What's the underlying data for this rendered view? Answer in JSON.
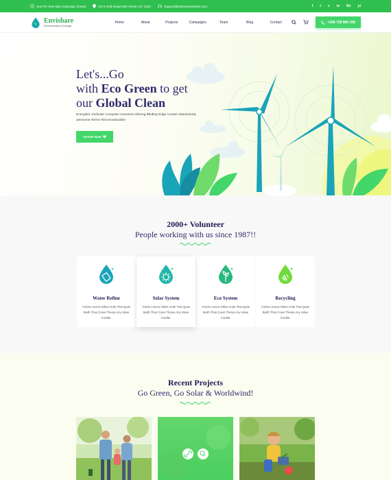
{
  "topbar": {
    "hours": "Sun-Fri: 9am-6pm Saturday Closed",
    "address": "4/2 K Soft Road 24th Street, NY 1202",
    "email": "Support@adminenvishare.com",
    "social": [
      "f",
      "t",
      "v",
      "in",
      "Be",
      "yt"
    ]
  },
  "nav": {
    "logo_name": "Envishare",
    "logo_sub": "Environmental & Ecology",
    "menu": [
      "Home",
      "About",
      "Projects",
      "Campaigns",
      "Team",
      "Blog",
      "Contact"
    ],
    "phone": "+208 728 980 158"
  },
  "hero": {
    "line1": "Let's...Go",
    "line2_pre": "with ",
    "line2_bold": "Eco Green",
    "line2_post": " to get",
    "line3_pre": "our ",
    "line3_bold": "Global Clean",
    "desc": "Energistic Sndicate Compete Conumes Aftering Bleding Edge Conten Interactively awesome theme Reconceptualize",
    "donate": "Donate Now"
  },
  "volunteer": {
    "title": "2000+ Volunteer",
    "subtitle": "People working with us since 1987!!",
    "cards": [
      {
        "title": "Water Refine",
        "desc": "Colors Levera Othes Ande That Quas Bedh Thos Cover Theme Any Value Cordite."
      },
      {
        "title": "Solar System",
        "desc": "Colors Levera Othes Ande That Quas Bedh Thos Cover Theme Any Value Cordite."
      },
      {
        "title": "Eco System",
        "desc": "Colors Levera Othes Ande That Quas Bedh Thos Cover Theme Any Value Cordite."
      },
      {
        "title": "Recycling",
        "desc": "Colors Levera Othes Ande That Quas Bedh Thos Cover Theme Any Value Cordite."
      }
    ]
  },
  "projects": {
    "title": "Recent Projects",
    "subtitle": "Go Green, Go Solar & Worldwind!"
  },
  "colors": {
    "accent": "#43d66a",
    "topbar": "#2fbf4f",
    "heading": "#1f1a55",
    "teal": "#1aa4b8"
  }
}
